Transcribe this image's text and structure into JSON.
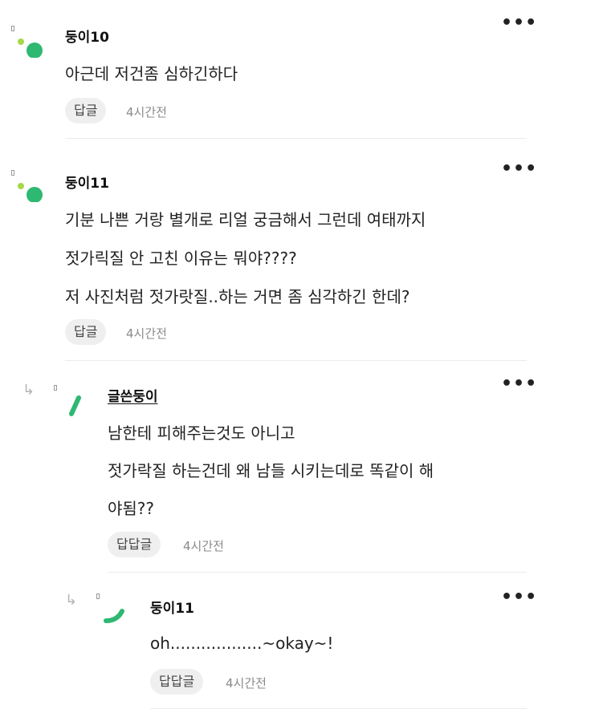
{
  "comments": [
    {
      "author": "둥이10",
      "lines": [
        "아근데 저건좀 심하긴하다"
      ],
      "reply_label": "답글",
      "time": "4시간전",
      "more": "•••"
    },
    {
      "author": "둥이11",
      "lines": [
        "기분 나쁜 거랑 별개로 리얼 궁금해서 그런데 여태까지",
        "젓가릭질 안 고친 이유는 뭐야????",
        "저 사진처럼 젓가랏질..하는 거면 좀 심각하긴 한데?"
      ],
      "reply_label": "답글",
      "time": "4시간전",
      "more": "•••"
    },
    {
      "author": "글쓴둥이",
      "lines": [
        "남한테 피해주는것도 아니고",
        "젓가락질 하는건데 왜 남들 시키는데로 똑같이 해",
        "야됨??"
      ],
      "reply_label": "답답글",
      "time": "4시간전",
      "more": "•••"
    },
    {
      "author": "둥이11",
      "lines": [
        "oh..................~okay~!"
      ],
      "reply_label": "답답글",
      "time": "4시간전",
      "more": "•••"
    }
  ],
  "colors": {
    "avatar_green": "#2eb872",
    "avatar_lime": "#a5d84a",
    "reply_button_bg": "#efefef",
    "time_text": "#8a8a8a"
  },
  "icons": {
    "reply_indicator": "reply-arrow-icon",
    "more": "more-options-icon"
  }
}
